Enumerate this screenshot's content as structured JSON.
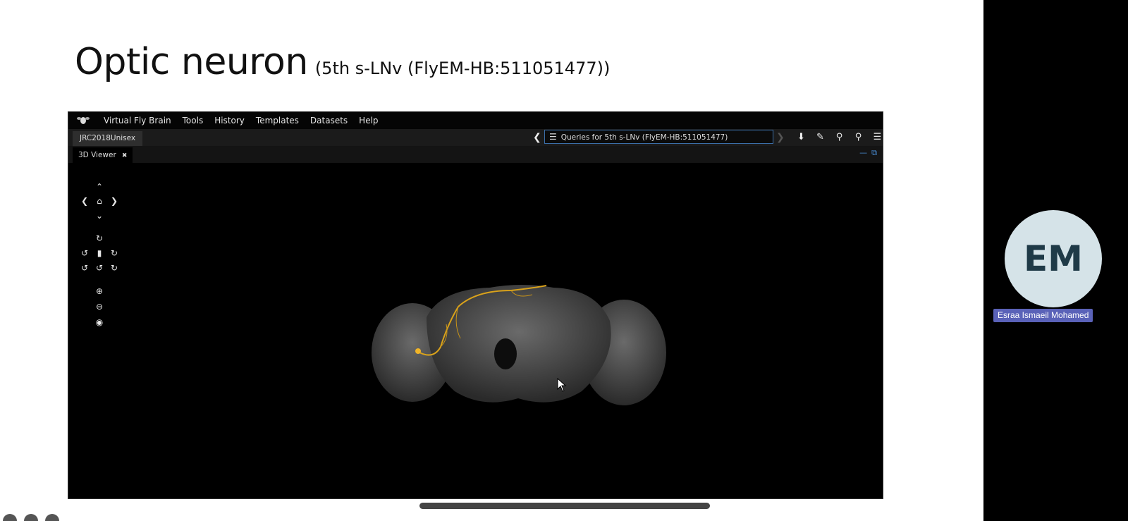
{
  "slide": {
    "title": "Optic neuron",
    "subtitle": "(5th s-LNv (FlyEM-HB:511051477))"
  },
  "app": {
    "menu": [
      "Virtual Fly Brain",
      "Tools",
      "History",
      "Templates",
      "Datasets",
      "Help"
    ],
    "template_tab": "JRC2018Unisex",
    "queries_label": "Queries for 5th s-LNv (FlyEM-HB:511051477)",
    "viewer_tab": "3D Viewer",
    "toolbar_icons": [
      "download-icon",
      "eraser-icon",
      "search-icon",
      "query-icon",
      "list-icon"
    ],
    "neuron_color": "#d9a21b"
  },
  "participant": {
    "initials": "EM",
    "name": "Esraa Ismaeil Mohamed"
  }
}
